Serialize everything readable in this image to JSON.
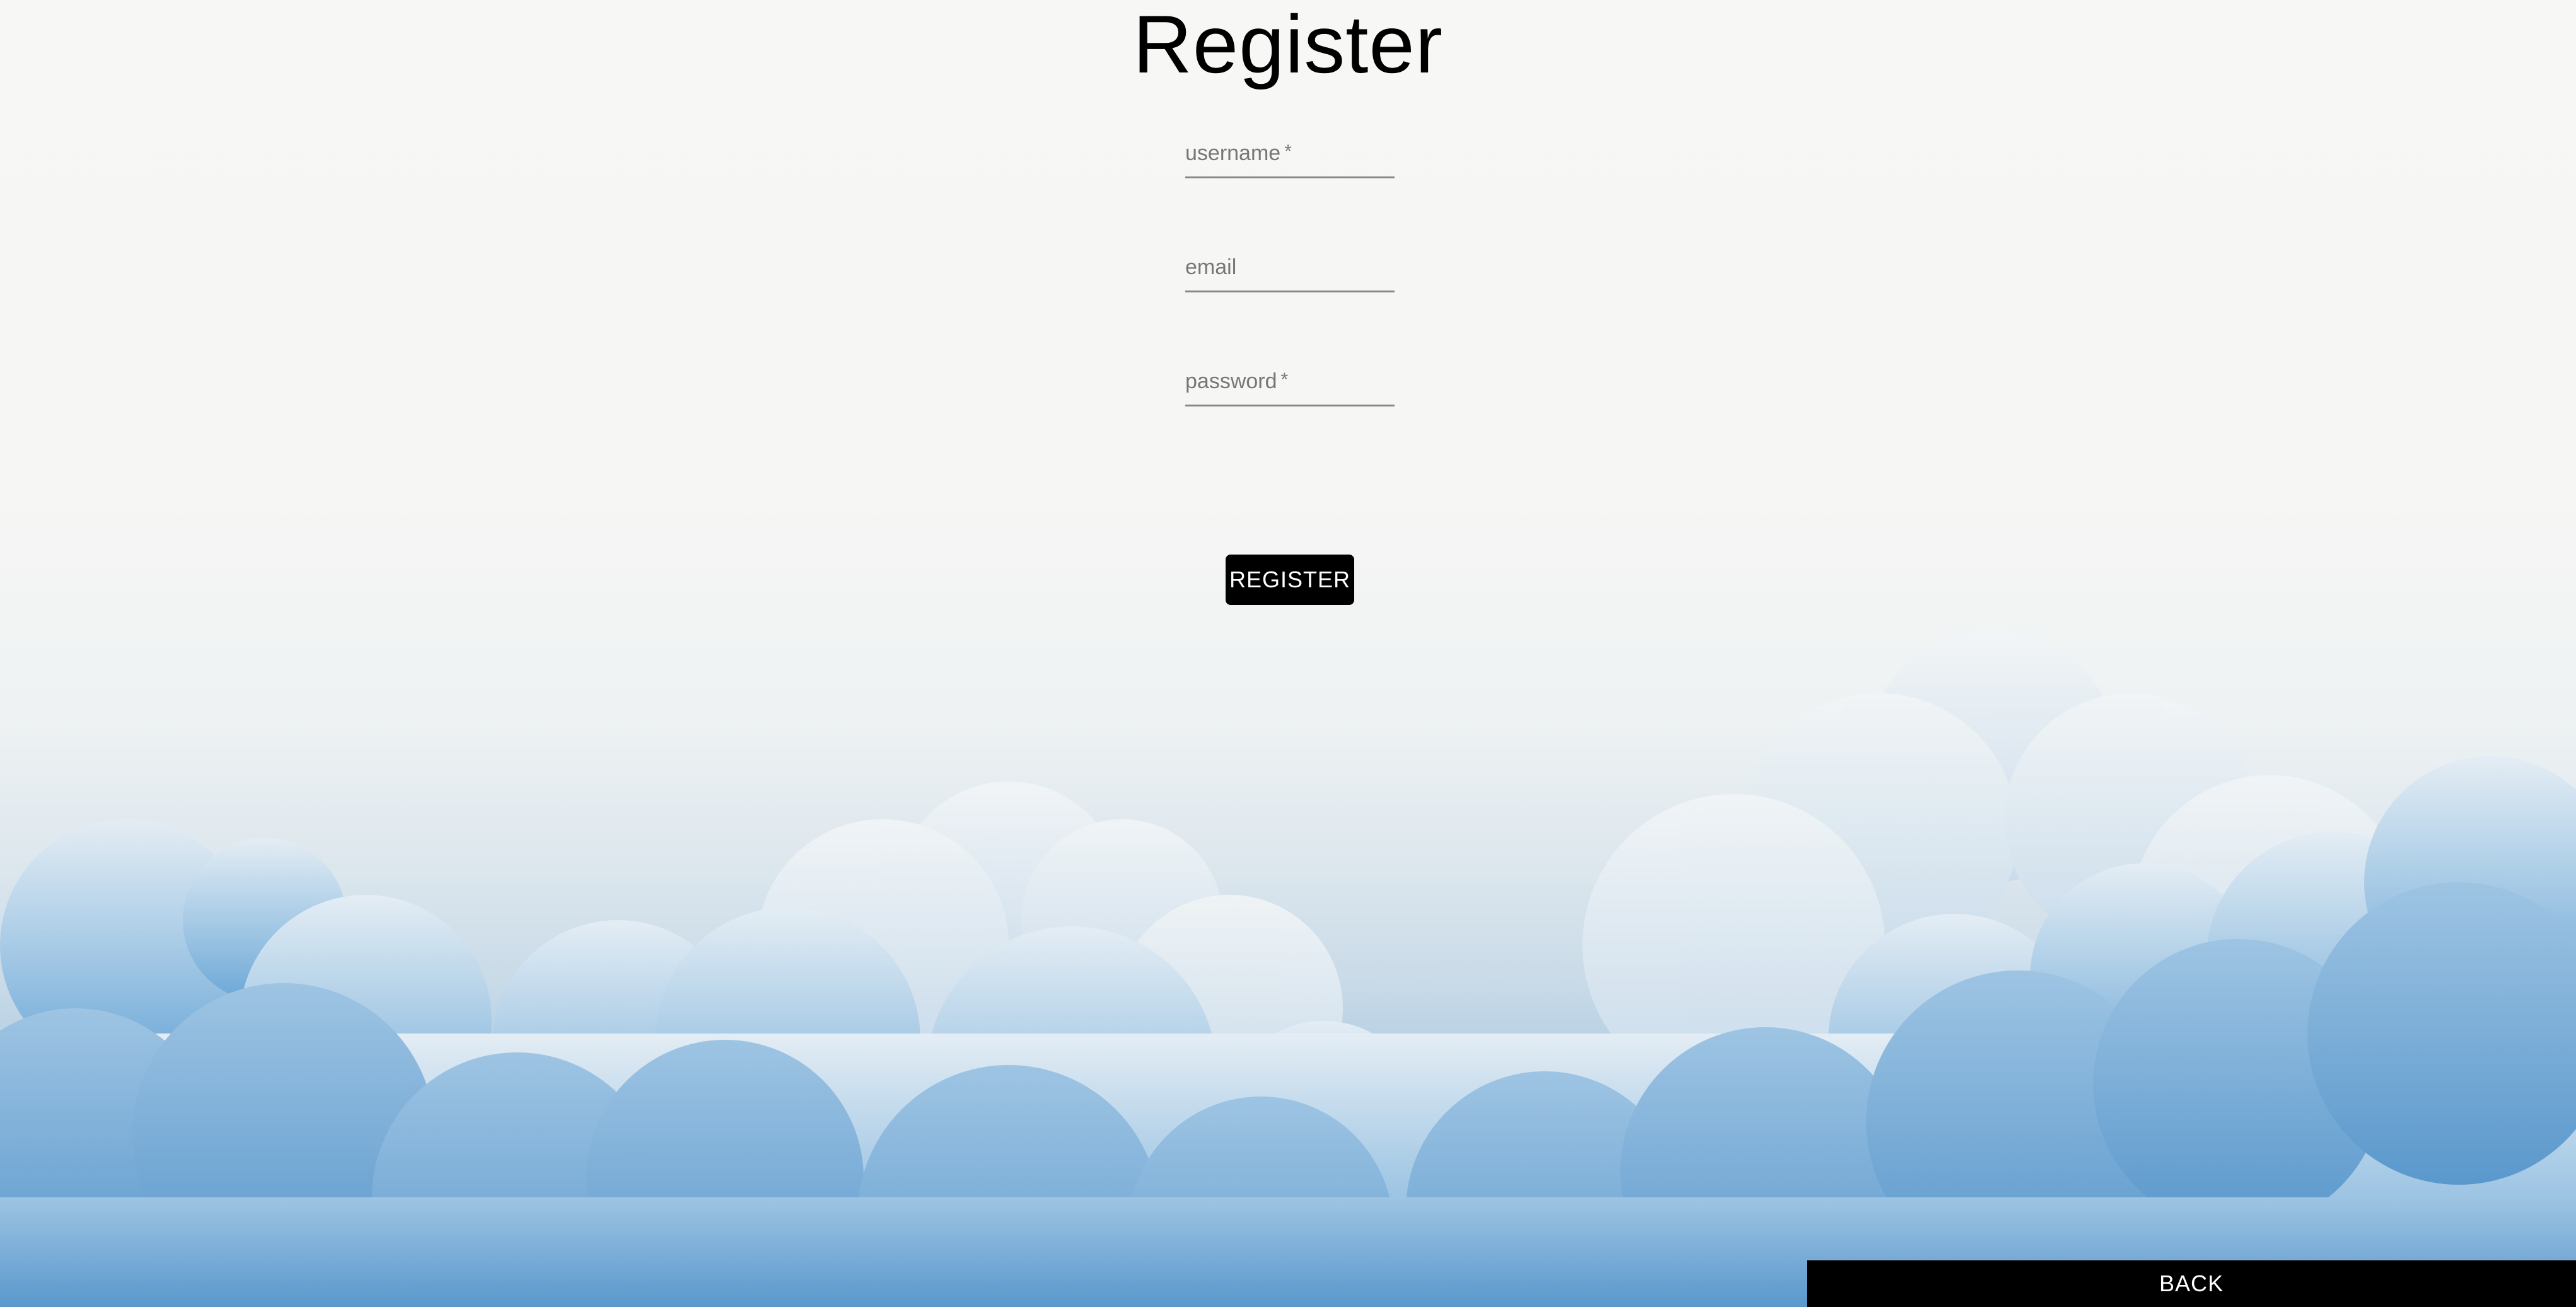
{
  "page": {
    "title": "Register"
  },
  "form": {
    "username": {
      "label": "username",
      "required_mark": "*",
      "value": ""
    },
    "email": {
      "label": "email",
      "value": ""
    },
    "password": {
      "label": "password",
      "required_mark": "*",
      "value": ""
    },
    "submit_label": "REGISTER"
  },
  "footer": {
    "back_label": "BACK"
  },
  "colors": {
    "sky_top": "#f7f7f5",
    "cloud_light": "#d8e6f1",
    "cloud_mid": "#8fbadf",
    "cloud_deep": "#5f9ccf",
    "button_bg": "#000000",
    "button_text": "#ffffff"
  },
  "background": {
    "description_icon": "cloud-sky-image"
  }
}
